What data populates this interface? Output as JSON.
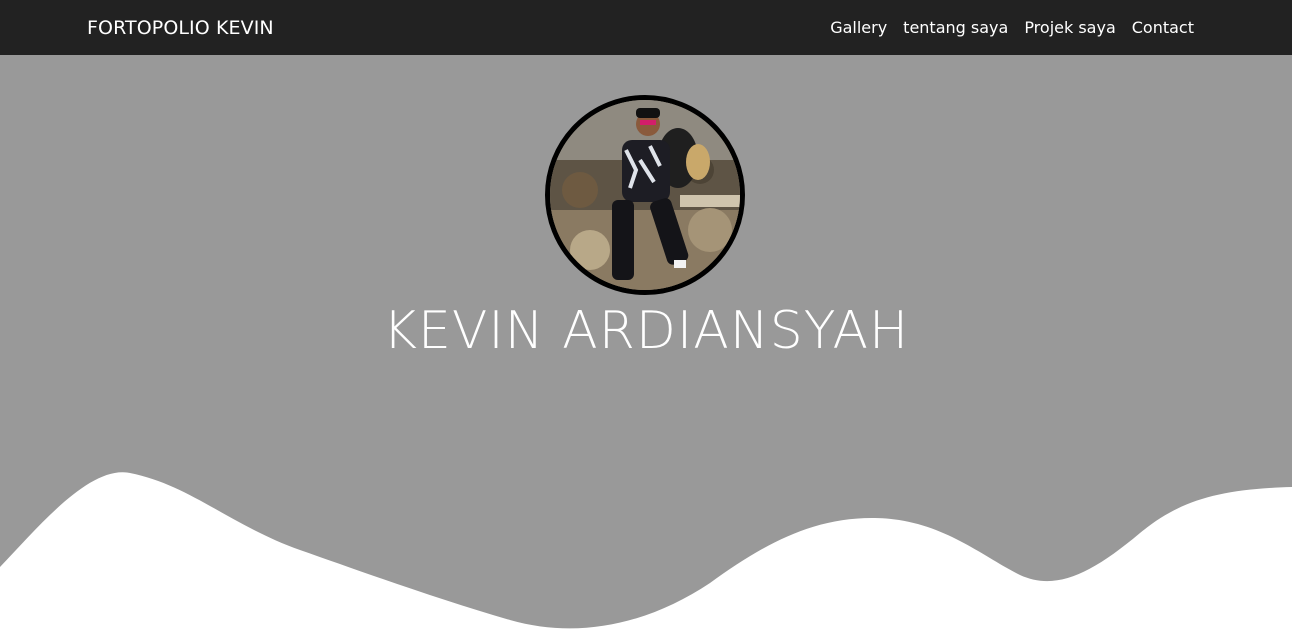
{
  "navbar": {
    "brand": "FORTOPOLIO KEVIN",
    "links": [
      {
        "label": "Gallery"
      },
      {
        "label": "tentang saya"
      },
      {
        "label": "Projek saya"
      },
      {
        "label": "Contact"
      }
    ]
  },
  "hero": {
    "name": "KEVIN ARDIANSYAH",
    "avatar_alt": "profile photo"
  },
  "colors": {
    "navbar_bg": "#222222",
    "hero_bg": "#999999",
    "wave": "#ffffff",
    "text": "#ffffff"
  }
}
